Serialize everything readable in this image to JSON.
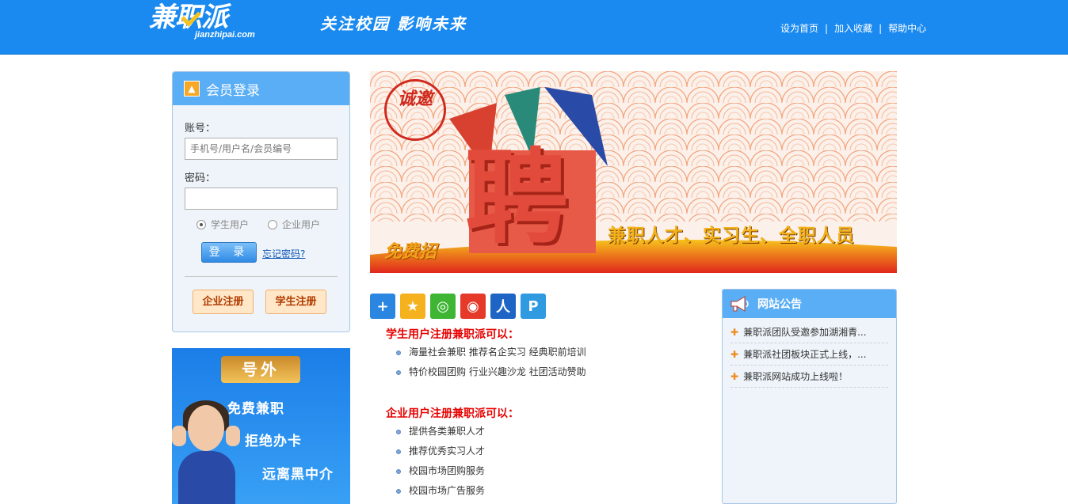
{
  "header": {
    "logo_text": "兼职派",
    "logo_sub": "jianzhipai.com",
    "slogan": "关注校园  影响未来",
    "links": [
      "设为首页",
      "加入收藏",
      "帮助中心"
    ],
    "separator": "|",
    "bg_color": "#1a8af0"
  },
  "login": {
    "title": "会员登录",
    "account_label": "账号：",
    "account_placeholder": "手机号/用户名/会员编号",
    "password_label": "密码：",
    "password_value": "",
    "user_types": [
      "学生用户",
      "企业用户"
    ],
    "selected_type": "学生用户",
    "login_button": "登 录",
    "forgot_link": "忘记密码?",
    "register_company": "企业注册",
    "register_student": "学生注册"
  },
  "side_ad": {
    "tag": "号外",
    "lines": [
      "免费兼职",
      "拒绝办卡",
      "远离黑中介"
    ]
  },
  "banner": {
    "seal": "诚邀",
    "big_char": "聘",
    "free_text": "免费招",
    "slogan": "兼职人才、实习生、全职人员"
  },
  "share_icons": [
    {
      "name": "share-plus-icon",
      "glyph": "+",
      "color": "#2a86e0"
    },
    {
      "name": "qzone-icon",
      "glyph": "★",
      "color": "#f5b21e"
    },
    {
      "name": "wechat-icon",
      "glyph": "◎",
      "color": "#3fb534"
    },
    {
      "name": "weibo-icon",
      "glyph": "◉",
      "color": "#e53a2a"
    },
    {
      "name": "renren-icon",
      "glyph": "人",
      "color": "#1d64c5"
    },
    {
      "name": "tencent-weibo-icon",
      "glyph": "P",
      "color": "#2f9ae0"
    }
  ],
  "student_section": {
    "title": "学生用户注册兼职派可以：",
    "items": [
      "海量社会兼职  推荐名企实习  经典职前培训",
      "特价校园团购  行业兴趣沙龙  社团活动赞助"
    ]
  },
  "company_section": {
    "title": "企业用户注册兼职派可以：",
    "items": [
      "提供各类兼职人才",
      "推荐优秀实习人才",
      "校园市场团购服务",
      "校园市场广告服务"
    ]
  },
  "notice": {
    "title": "网站公告",
    "items": [
      "兼职派团队受邀参加湖湘青...",
      "兼职派社团板块正式上线，...",
      "兼职派网站成功上线啦！"
    ]
  }
}
